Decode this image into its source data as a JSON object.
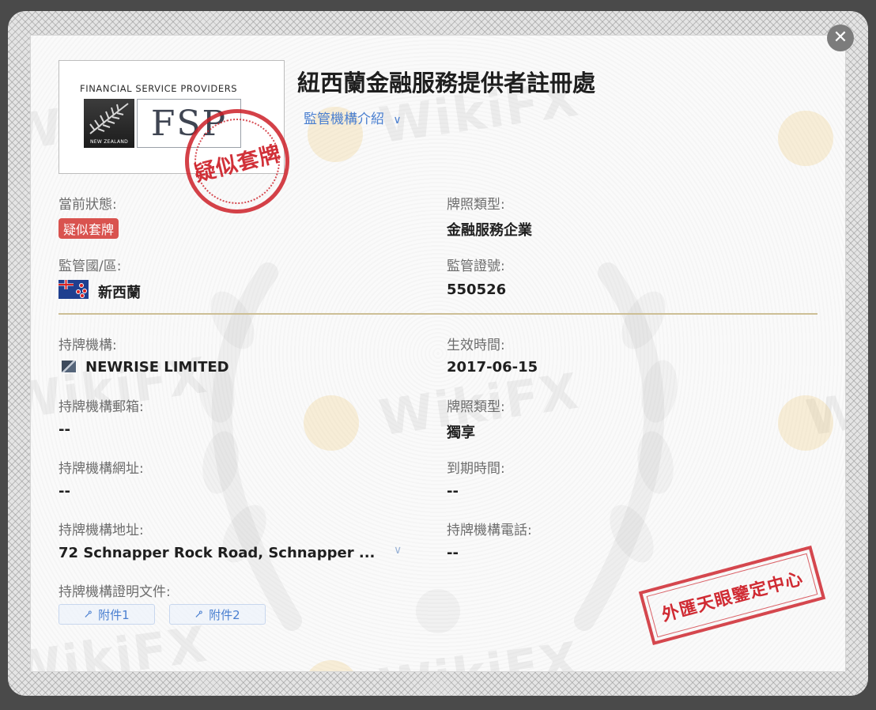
{
  "close": {
    "glyph": "✕"
  },
  "logo": {
    "caption": "FINANCIAL SERVICE PROVIDERS",
    "fern_text": "NEW ZEALAND",
    "fsp_text": "FSP"
  },
  "stamp": {
    "text": "疑似套牌"
  },
  "title": "紐西蘭金融服務提供者註冊處",
  "intro_link": {
    "label": "監管機構介紹",
    "chevron": "∨"
  },
  "watermark": {
    "text": "WikiFX"
  },
  "fields": {
    "current_status": {
      "label": "當前狀態:",
      "value": "疑似套牌"
    },
    "license_type": {
      "label": "牌照類型:",
      "value": "金融服務企業"
    },
    "region": {
      "label": "監管國/區:",
      "value": "新西蘭"
    },
    "license_number": {
      "label": "監管證號:",
      "value": "550526"
    },
    "licensed_entity": {
      "label": "持牌機構:",
      "value": "NEWRISE LIMITED"
    },
    "effective_date": {
      "label": "生效時間:",
      "value": "2017-06-15"
    },
    "entity_email": {
      "label": "持牌機構郵箱:",
      "value": "--"
    },
    "license_type_2": {
      "label": "牌照類型:",
      "value": "獨享"
    },
    "entity_website": {
      "label": "持牌機構網址:",
      "value": "--"
    },
    "expiry_date": {
      "label": "到期時間:",
      "value": "--"
    },
    "entity_address": {
      "label": "持牌機構地址:",
      "value": "72 Schnapper Rock Road, Schnapper ..."
    },
    "entity_phone": {
      "label": "持牌機構電話:",
      "value": "--"
    },
    "entity_documents": {
      "label": "持牌機構證明文件:"
    }
  },
  "attachments": [
    {
      "label": "附件1"
    },
    {
      "label": "附件2"
    }
  ],
  "address_expand": {
    "glyph": "∨"
  },
  "verify_stamp": {
    "text": "外匯天眼鑒定中心"
  },
  "colors": {
    "accent_link": "#4a7fd0",
    "badge_red": "#d9534f",
    "stamp_red": "#cd2028",
    "divider_gold": "#cdbf96"
  }
}
